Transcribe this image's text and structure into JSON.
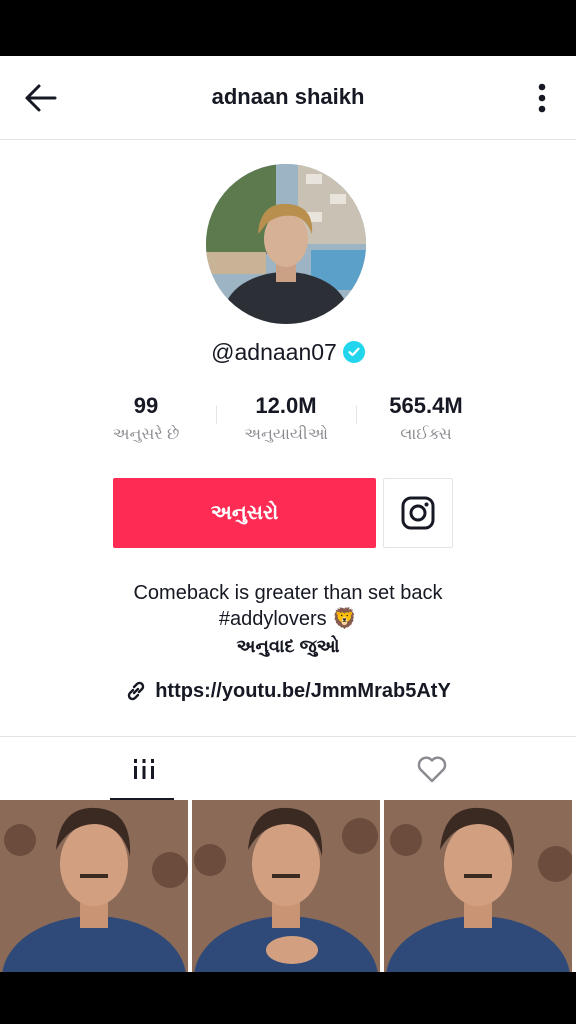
{
  "header": {
    "title": "adnaan shaikh",
    "back_icon": "arrow-left-icon",
    "more_icon": "more-vertical-icon"
  },
  "profile": {
    "handle": "@adnaan07",
    "verified_icon": "verified-check-icon",
    "avatar_icon": "profile-avatar"
  },
  "stats": [
    {
      "value": "99",
      "label": "અનુસરે છે"
    },
    {
      "value": "12.0M",
      "label": "અનુયાયીઓ"
    },
    {
      "value": "565.4M",
      "label": "લાઈક્સ"
    }
  ],
  "actions": {
    "follow_label": "અનુસરો",
    "instagram_icon": "instagram-icon"
  },
  "bio": {
    "line1": "Comeback is greater than set back",
    "line2": "#addylovers 🦁",
    "translate_label": "અનુવાદ જુઓ",
    "link_icon": "link-icon",
    "link": "https://youtu.be/JmmMrab5AtY"
  },
  "tabs": [
    {
      "icon": "videos-grid-icon",
      "active": true
    },
    {
      "icon": "heart-icon",
      "active": false
    }
  ],
  "videos": [
    {
      "icon": "video-thumbnail"
    },
    {
      "icon": "video-thumbnail"
    },
    {
      "icon": "video-thumbnail"
    }
  ],
  "colors": {
    "accent": "#fe2c55",
    "verified": "#20d5ec",
    "text": "#161823",
    "muted": "#8a8b91"
  }
}
